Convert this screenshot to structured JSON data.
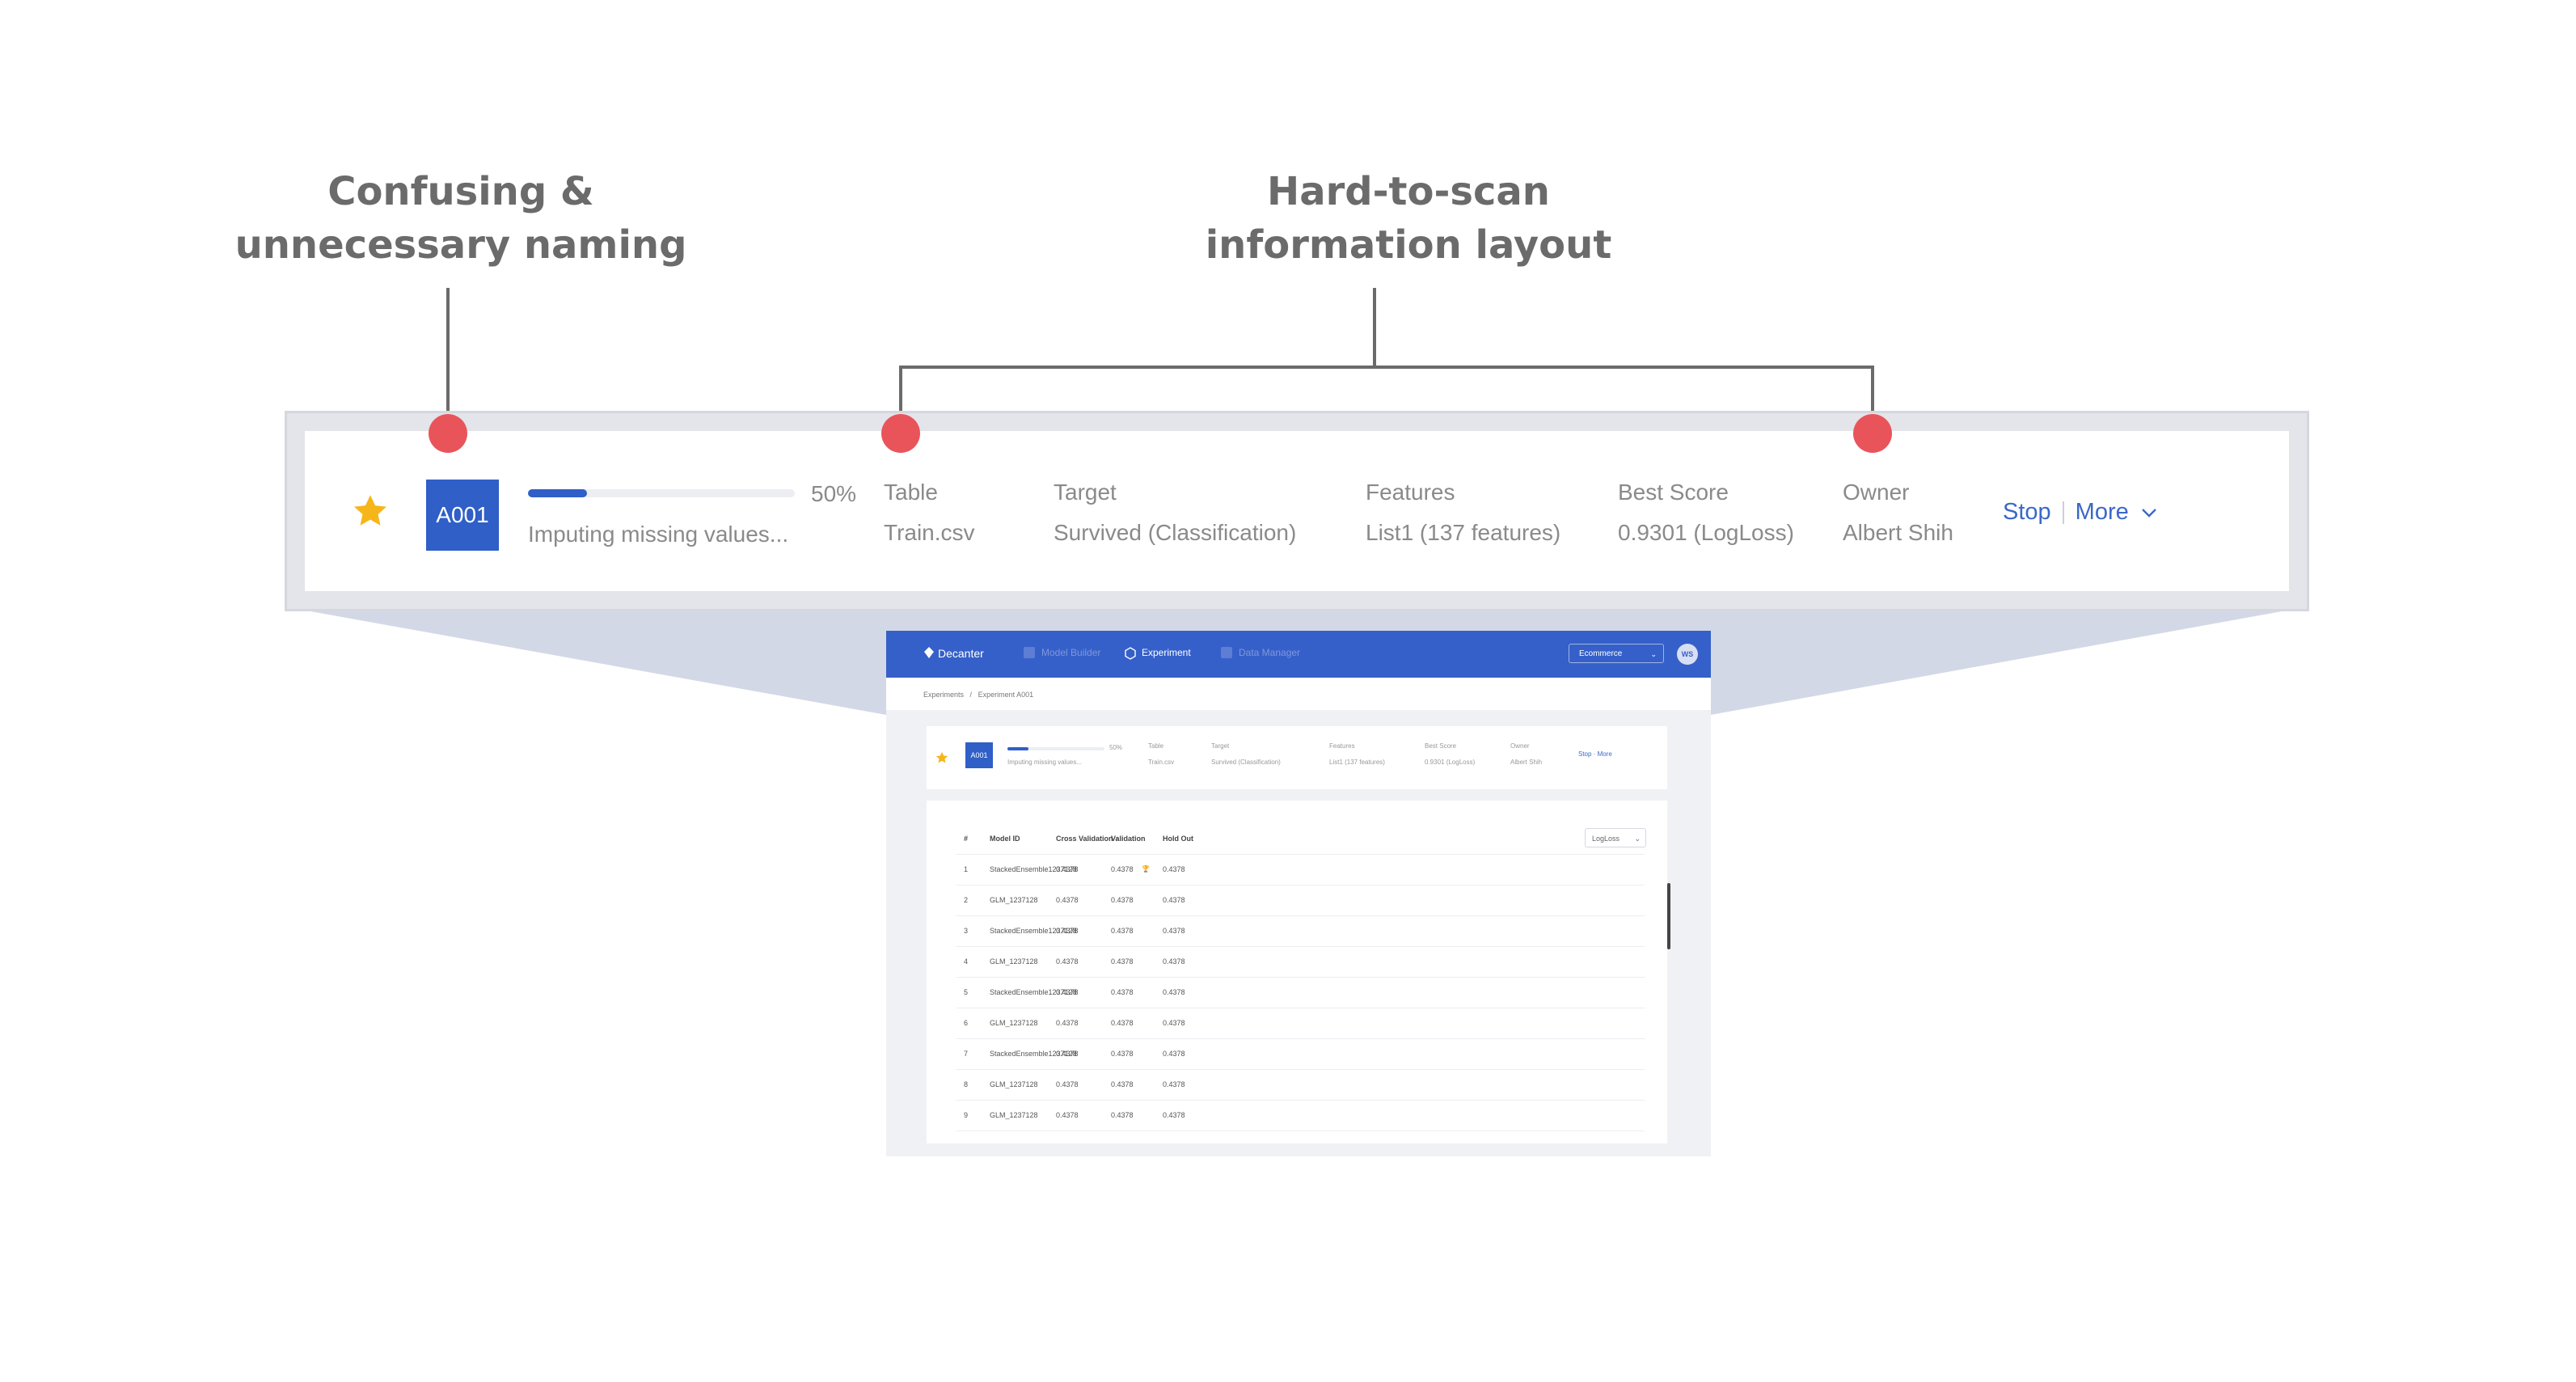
{
  "annotations": {
    "left": {
      "line1": "Confusing &",
      "line2": "unnecessary naming"
    },
    "right": {
      "line1": "Hard-to-scan",
      "line2": "information layout"
    }
  },
  "colors": {
    "accent": "#2f5fc7",
    "annotation_dot": "#e9545b",
    "star": "#f6b61a",
    "nav": "#3660c9"
  },
  "zoom_card": {
    "star_icon": "star-icon",
    "id_badge": "A001",
    "progress": {
      "percent_value": 0.5,
      "percent_label": "50%",
      "status": "Imputing missing values..."
    },
    "fields": [
      {
        "label": "Table",
        "value": "Train.csv"
      },
      {
        "label": "Target",
        "value": "Survived (Classification)"
      },
      {
        "label": "Features",
        "value": "List1 (137 features)"
      },
      {
        "label": "Best Score",
        "value": "0.9301 (LogLoss)"
      },
      {
        "label": "Owner",
        "value": "Albert Shih"
      }
    ],
    "actions": {
      "stop": "Stop",
      "more": "More"
    }
  },
  "app": {
    "nav": {
      "brand": "Decanter",
      "items": [
        "Model Builder",
        "Experiment",
        "Data Manager"
      ],
      "active": "Experiment",
      "env_select": "Ecommerce",
      "avatar": "WS"
    },
    "breadcrumb": {
      "root": "Experiments",
      "separator": "/",
      "current": "Experiment A001"
    },
    "card": {
      "id_badge": "A001",
      "percent_label": "50%",
      "status": "Imputing missing values...",
      "fields": [
        {
          "label": "Table",
          "value": "Train.csv"
        },
        {
          "label": "Target",
          "value": "Survived (Classification)"
        },
        {
          "label": "Features",
          "value": "List1 (137 features)"
        },
        {
          "label": "Best Score",
          "value": "0.9301 (LogLoss)"
        },
        {
          "label": "Owner",
          "value": "Albert Shih"
        }
      ],
      "actions": "Stop · More"
    },
    "table": {
      "metric_select": "LogLoss",
      "headers": [
        "#",
        "Model ID",
        "Cross Validation ↑",
        "Validation",
        "Hold Out"
      ],
      "rows": [
        [
          "1",
          "StackedEnsemble1237128",
          "0.4378",
          "0.4378",
          "0.4378"
        ],
        [
          "2",
          "GLM_1237128",
          "0.4378",
          "0.4378",
          "0.4378"
        ],
        [
          "3",
          "StackedEnsemble1237128",
          "0.4378",
          "0.4378",
          "0.4378"
        ],
        [
          "4",
          "GLM_1237128",
          "0.4378",
          "0.4378",
          "0.4378"
        ],
        [
          "5",
          "StackedEnsemble1237128",
          "0.4378",
          "0.4378",
          "0.4378"
        ],
        [
          "6",
          "GLM_1237128",
          "0.4378",
          "0.4378",
          "0.4378"
        ],
        [
          "7",
          "StackedEnsemble1237128",
          "0.4378",
          "0.4378",
          "0.4378"
        ],
        [
          "8",
          "GLM_1237128",
          "0.4378",
          "0.4378",
          "0.4378"
        ],
        [
          "9",
          "GLM_1237128",
          "0.4378",
          "0.4378",
          "0.4378"
        ]
      ]
    }
  }
}
